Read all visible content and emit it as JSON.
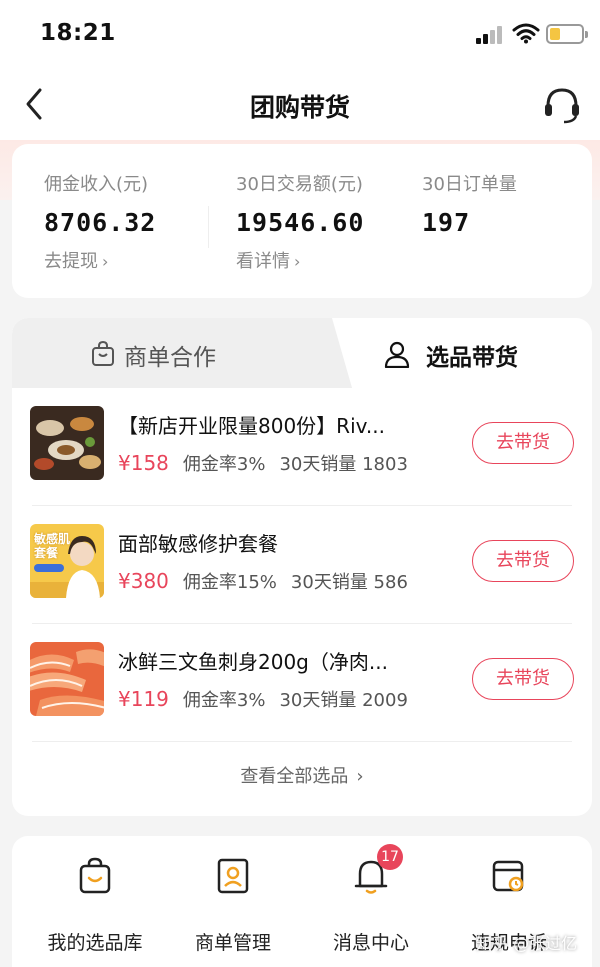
{
  "status_bar": {
    "time": "18:21"
  },
  "nav": {
    "title": "团购带货"
  },
  "stats": [
    {
      "label": "佣金收入(元)",
      "value": "8706.32",
      "link": "去提现"
    },
    {
      "label": "30日交易额(元)",
      "value": "19546.60",
      "link": "看详情"
    },
    {
      "label": "30日订单量",
      "value": "197",
      "link": ""
    }
  ],
  "tabs": [
    {
      "label": "商单合作",
      "icon": "shopping-bag-icon",
      "active": false
    },
    {
      "label": "选品带货",
      "icon": "person-icon",
      "active": true
    }
  ],
  "products": [
    {
      "title": "【新店开业限量800份】Riv...",
      "price": "¥158",
      "rate": "佣金率3%",
      "sales": "30天销量 1803",
      "button": "去带货",
      "thumb": "food-platter-image"
    },
    {
      "title": "面部敏感修护套餐",
      "price": "¥380",
      "rate": "佣金率15%",
      "sales": "30天销量 586",
      "button": "去带货",
      "thumb": "skincare-promo-image",
      "thumb_text": [
        "敏感肌",
        "套餐"
      ]
    },
    {
      "title": "冰鲜三文鱼刺身200g（净肉...",
      "price": "¥119",
      "rate": "佣金率3%",
      "sales": "30天销量 2009",
      "button": "去带货",
      "thumb": "salmon-sashimi-image"
    }
  ],
  "see_all": "查看全部选品",
  "tools": [
    {
      "label": "我的选品库",
      "icon": "bag-smile-icon"
    },
    {
      "label": "商单管理",
      "icon": "id-card-icon"
    },
    {
      "label": "消息中心",
      "icon": "bell-icon",
      "badge": "17"
    },
    {
      "label": "违规申诉",
      "icon": "appeal-card-icon"
    }
  ],
  "watermark": "知乎 @张过亿",
  "colors": {
    "accent": "#e8455b",
    "background": "#f4f4f4",
    "band": "#fde9e5"
  }
}
